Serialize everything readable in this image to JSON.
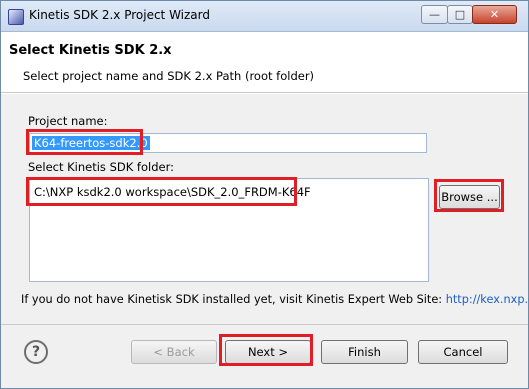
{
  "window": {
    "title": "Kinetis SDK 2.x Project Wizard",
    "controls": {
      "minimize": "—",
      "maximize": "□",
      "close": "✕"
    }
  },
  "header": {
    "title": "Select Kinetis SDK 2.x",
    "subtitle": "Select project name and SDK 2.x Path (root folder)"
  },
  "form": {
    "project_name_label": "Project name:",
    "project_name_value": "K64-freertos-sdk2.0",
    "sdk_folder_label": "Select Kinetis SDK folder:",
    "sdk_folder_value": "C:\\NXP ksdk2.0 workspace\\SDK_2.0_FRDM-K64F",
    "browse_label": "Browse ..."
  },
  "info": {
    "text": "If you do not have Kinetisk SDK installed yet, visit Kinetis Expert Web Site: ",
    "link": "http://kex.nxp.com"
  },
  "footer": {
    "help_icon": "?",
    "back_label": "< Back",
    "next_label": "Next >",
    "finish_label": "Finish",
    "cancel_label": "Cancel"
  },
  "colors": {
    "highlight": "#e01e26",
    "selection": "#3399ff",
    "link": "#1a5ec9"
  }
}
